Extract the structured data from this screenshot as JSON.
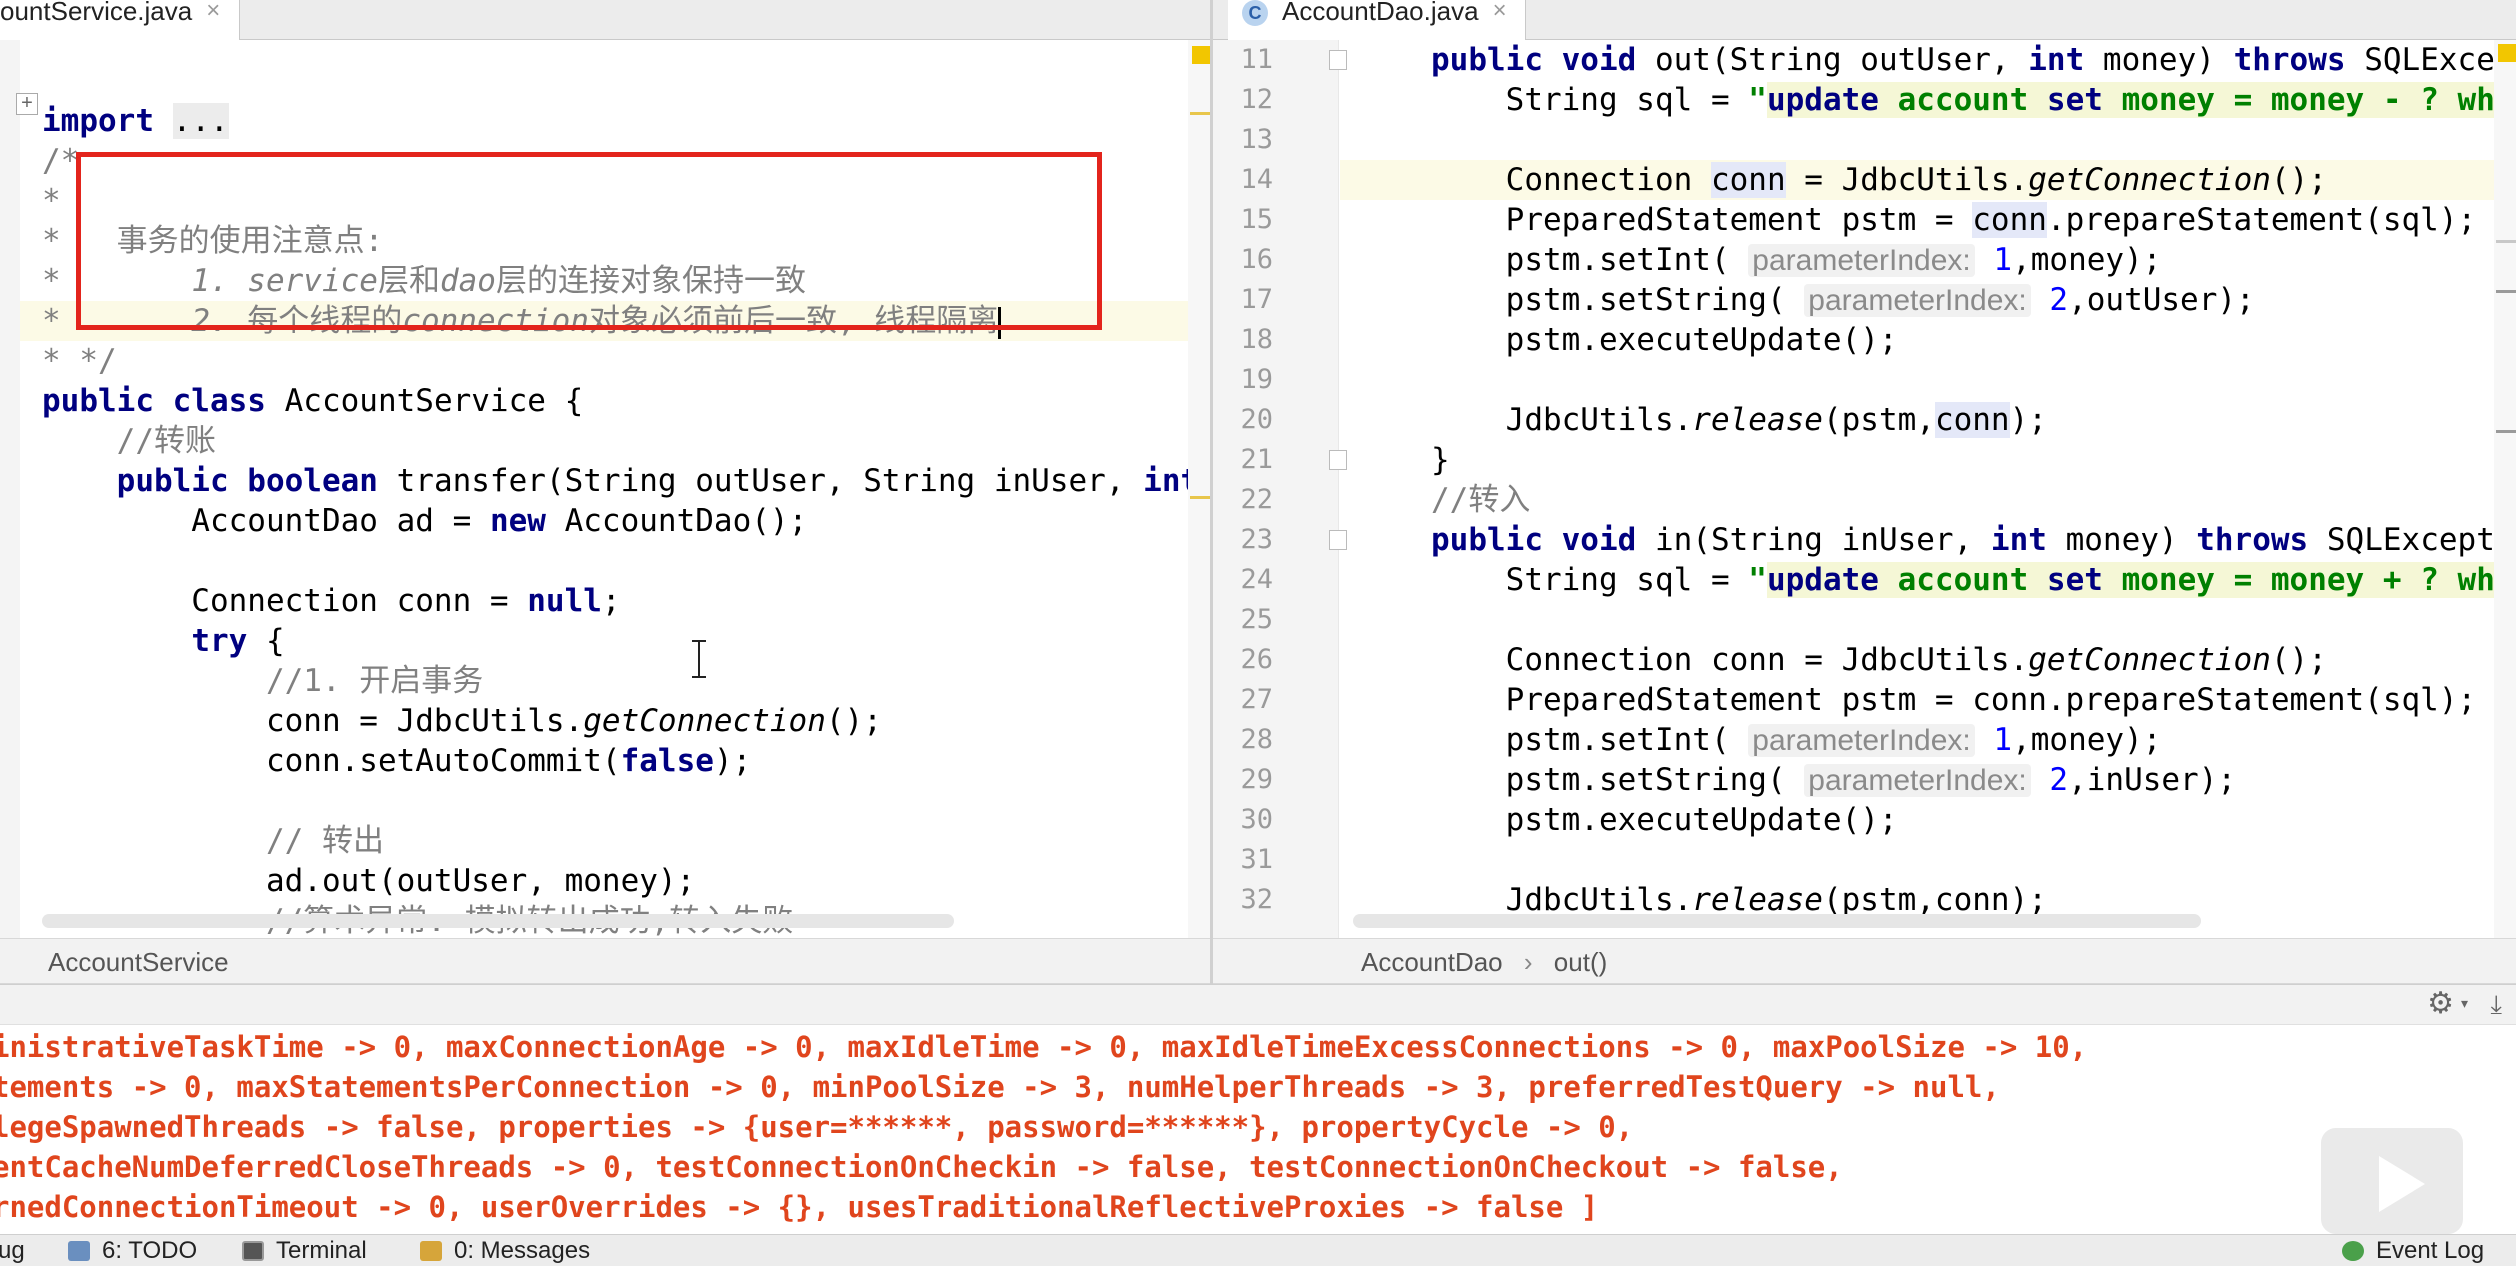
{
  "tabs_left": {
    "label": "ountService.java",
    "close": "×"
  },
  "tabs_right": {
    "label": "AccountDao.java",
    "close": "×",
    "icon_letter": "C"
  },
  "left_editor": {
    "lines": [
      {
        "code": "import ..."
      },
      {
        "code": "/*"
      },
      {
        "code": "*"
      },
      {
        "code": "*   事务的使用注意点:"
      },
      {
        "code": "*       1. service层和dao层的连接对象保持一致"
      },
      {
        "code": "*       2. 每个线程的connection对象必须前后一致, 线程隔离"
      },
      {
        "code": "* */"
      },
      {
        "code": "public class AccountService {"
      },
      {
        "code": "    //转账"
      },
      {
        "code": "    public boolean transfer(String outUser, String inUser, int"
      },
      {
        "code": "        AccountDao ad = new AccountDao();"
      },
      {
        "code": ""
      },
      {
        "code": "        Connection conn = null;"
      },
      {
        "code": "        try {"
      },
      {
        "code": "            //1. 开启事务"
      },
      {
        "code": "            conn = JdbcUtils.getConnection();"
      },
      {
        "code": "            conn.setAutoCommit(false);"
      },
      {
        "code": ""
      },
      {
        "code": "            // 转出"
      },
      {
        "code": "            ad.out(outUser, money);"
      },
      {
        "code": "            //算术异常: 模拟转出成功,转入失败"
      }
    ]
  },
  "right_editor": {
    "line_numbers": [
      "11",
      "12",
      "13",
      "14",
      "15",
      "16",
      "17",
      "18",
      "19",
      "20",
      "21",
      "22",
      "23",
      "24",
      "25",
      "26",
      "27",
      "28",
      "29",
      "30",
      "31",
      "32"
    ],
    "hints": {
      "p1": "parameterIndex:",
      "p2": "parameterIndex:"
    }
  },
  "breadcrumb_left": {
    "item": "AccountService"
  },
  "breadcrumb_right": {
    "item1": "AccountDao",
    "sep": "›",
    "item2": "out()"
  },
  "console": {
    "lines": [
      "inistrativeTaskTime -> 0, maxConnectionAge -> 0, maxIdleTime -> 0, maxIdleTimeExcessConnections -> 0, maxPoolSize -> 10,",
      "tements -> 0, maxStatementsPerConnection -> 0, minPoolSize -> 3, numHelperThreads -> 3, preferredTestQuery -> null,",
      "legeSpawnedThreads -> false, properties -> {user=******, password=******}, propertyCycle -> 0,",
      "entCacheNumDeferredCloseThreads -> 0, testConnectionOnCheckin -> false, testConnectionOnCheckout -> false,",
      "rnedConnectionTimeout -> 0, userOverrides -> {}, usesTraditionalReflectiveProxies -> false ]"
    ]
  },
  "status_bar": {
    "debug": "ug",
    "todo": "6: TODO",
    "terminal": "Terminal",
    "messages": "0: Messages",
    "event_log": "Event Log"
  },
  "colors": {
    "annotation_box": "#e3241c",
    "console_text": "#e0451d"
  }
}
